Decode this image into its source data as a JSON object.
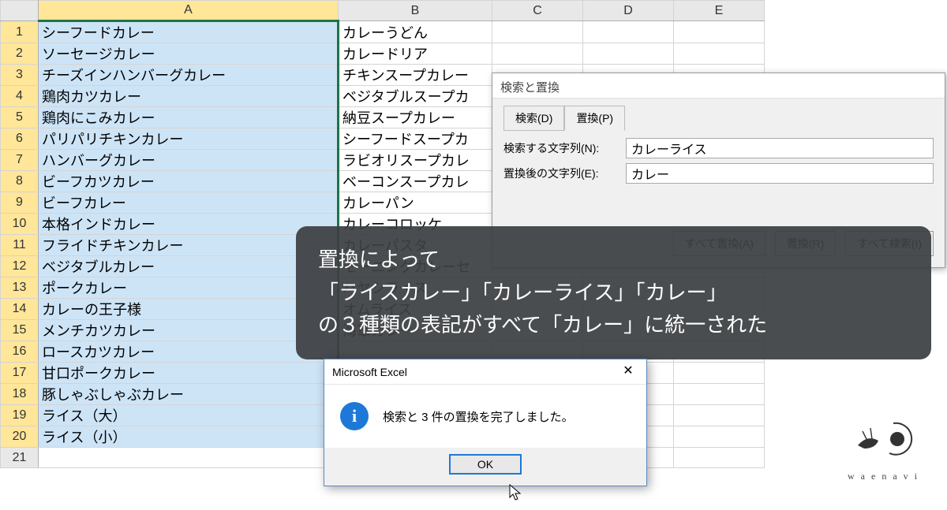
{
  "columns": [
    "A",
    "B",
    "C",
    "D",
    "E"
  ],
  "rows": [
    "1",
    "2",
    "3",
    "4",
    "5",
    "6",
    "7",
    "8",
    "9",
    "10",
    "11",
    "12",
    "13",
    "14",
    "15",
    "16",
    "17",
    "18",
    "19",
    "20",
    "21"
  ],
  "cellsA": [
    "シーフードカレー",
    "ソーセージカレー",
    "チーズインハンバーグカレー",
    "鶏肉カツカレー",
    "鶏肉にこみカレー",
    "パリパリチキンカレー",
    "ハンバーグカレー",
    "ビーフカツカレー",
    "ビーフカレー",
    "本格インドカレー",
    "フライドチキンカレー",
    "ベジタブルカレー",
    "ポークカレー",
    "カレーの王子様",
    "メンチカツカレー",
    "ロースカツカレー",
    "甘口ポークカレー",
    "豚しゃぶしゃぶカレー",
    "ライス（大）",
    "ライス（小）",
    ""
  ],
  "cellsB": [
    "カレーうどん",
    "カレードリア",
    "チキンスープカレー",
    "ベジタブルスープカ",
    "納豆スープカレー",
    "シーフードスープカ",
    "ラビオリスープカレ",
    "ベーコンスープカレ",
    "カレーパン",
    "カレーコロッケ",
    "カレーパスタ",
    "モーニングカレーセ",
    "ハヤシライス",
    "オムライス",
    "海軍カレー",
    "",
    "",
    "",
    "",
    "",
    ""
  ],
  "findreplace": {
    "title": "検索と置換",
    "tab_find": "検索(D)",
    "tab_replace": "置換(P)",
    "label_find": "検索する文字列(N):",
    "label_replace": "置換後の文字列(E):",
    "value_find": "カレーライス",
    "value_replace": "カレー",
    "btn_replace_all": "すべて置換(A)",
    "btn_replace": "置換(R)",
    "btn_find_all": "すべて検索(I)"
  },
  "note": {
    "line1": "置換によって",
    "line2": "「ライスカレー」「カレーライス」「カレー」",
    "line3": "の３種類の表記がすべて「カレー」に統一された"
  },
  "msgbox": {
    "title": "Microsoft Excel",
    "message": "検索と 3 件の置換を完了しました。",
    "ok": "OK",
    "close": "✕",
    "icon": "i"
  },
  "watermark": {
    "text": "waenavi"
  }
}
